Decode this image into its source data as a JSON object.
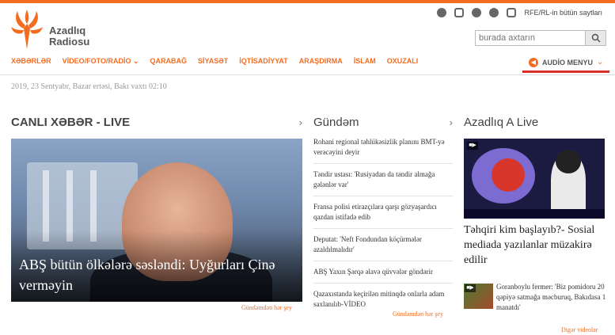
{
  "brand": {
    "line1": "Azadlıq",
    "line2": "Radiosu"
  },
  "header": {
    "rfe_link": "RFE/RL-in bütün saytları"
  },
  "search": {
    "placeholder": "burada axtarın"
  },
  "nav": [
    "XƏBƏRLƏR",
    "VİDEO/FOTO/RADİO",
    "QARABAĞ",
    "SİYASƏT",
    "İQTİSADİYYAT",
    "ARAŞDIRMA",
    "İSLAM",
    "OXUZALI"
  ],
  "audio_menu": "AUDİO MENYU",
  "date": "2019, 23 Sentyabr, Bazar ertəsi, Bakı vaxtı 02:10",
  "columns": {
    "live_news": "CANLI XƏBƏR - LIVE",
    "agenda": "Gündəm",
    "live_tv": "Azadlıq A Live"
  },
  "main_story": {
    "title": "ABŞ bütün ölkələrə səsləndi: Uyğurları Çinə verməyin"
  },
  "agenda_items": [
    "Rohani regional təhlükəsizlik planını BMT-yə verəcəyini deyir",
    "Təndir ustası: 'Rusiyadan da təndir almağa gələnlər var'",
    "Fransa polisi etirazçılara qarşı gözyaşardıcı qazdan istifadə edib",
    "Deputat: 'Neft Fondundan köçürmələr azaldılmalıdır'",
    "ABŞ Yaxın Şərqə əlavə qüvvələr göndərir",
    "Qazaxıstanda keçirilən mitinqdə onlarla adam saxlanılıb-VİDEO"
  ],
  "more_links": {
    "left": "Gündəmdən hər şey",
    "mid": "Gündəmdən hər şey",
    "right": "Digər videolar"
  },
  "live_story": {
    "title": "Təhqiri kim başlayıb?- Sosial mediada yazılanlar müzakirə edilir"
  },
  "video_story": {
    "title": "Goranboylu fermer: 'Biz pomidoru 20 qəpiyə satmağa məcburuq, Bakıdasa 1 manatdı'"
  },
  "colors": {
    "accent": "#f26d21",
    "audio_underline": "#d93025"
  }
}
